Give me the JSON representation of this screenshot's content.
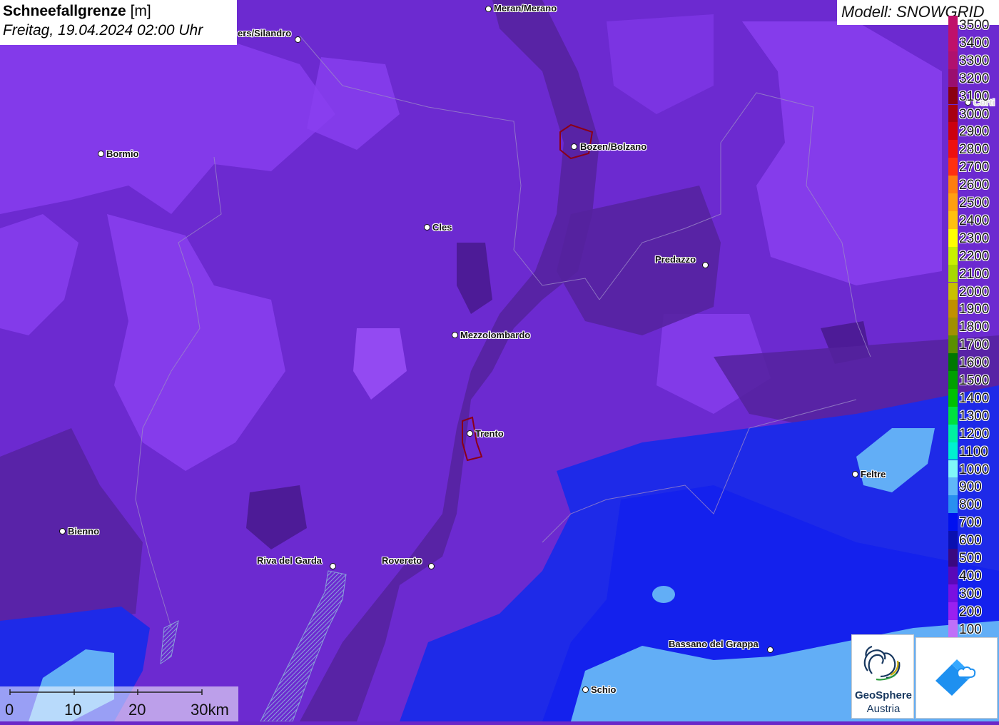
{
  "title": {
    "variable": "Schneefallgrenze",
    "unit": "[m]",
    "datetime": "Freitag, 19.04.2024 02:00 Uhr"
  },
  "model": "Modell: SNOWGRID",
  "cities": [
    {
      "name": "Meran/Merano"
    },
    {
      "name": "ers/Silandro"
    },
    {
      "name": "Bormio"
    },
    {
      "name": "Bozen/Bolzano"
    },
    {
      "name": "Cles"
    },
    {
      "name": "Predazzo"
    },
    {
      "name": "Mezzolombardo"
    },
    {
      "name": "Trento"
    },
    {
      "name": "Feltre"
    },
    {
      "name": "Bienno"
    },
    {
      "name": "Riva del Garda"
    },
    {
      "name": "Rovereto"
    },
    {
      "name": "Bassano del Grappa"
    },
    {
      "name": "Schio"
    },
    {
      "name": "Corti"
    }
  ],
  "legend": [
    {
      "label": "3500",
      "color": "#c0106a"
    },
    {
      "label": "3400",
      "color": "#c0106a"
    },
    {
      "label": "3300",
      "color": "#b0106e"
    },
    {
      "label": "3200",
      "color": "#9a0e6e"
    },
    {
      "label": "3100",
      "color": "#8b0010"
    },
    {
      "label": "3000",
      "color": "#a80010"
    },
    {
      "label": "2900",
      "color": "#cc0010"
    },
    {
      "label": "2800",
      "color": "#ee1010"
    },
    {
      "label": "2700",
      "color": "#ff3010"
    },
    {
      "label": "2600",
      "color": "#ff7e10"
    },
    {
      "label": "2500",
      "color": "#ffa010"
    },
    {
      "label": "2400",
      "color": "#ffc010"
    },
    {
      "label": "2300",
      "color": "#ffff00"
    },
    {
      "label": "2200",
      "color": "#c8f000"
    },
    {
      "label": "2100",
      "color": "#a8d800"
    },
    {
      "label": "2000",
      "color": "#c8c000"
    },
    {
      "label": "1900",
      "color": "#c09000"
    },
    {
      "label": "1800",
      "color": "#a09000"
    },
    {
      "label": "1700",
      "color": "#5a9000"
    },
    {
      "label": "1600",
      "color": "#007800"
    },
    {
      "label": "1500",
      "color": "#00a000"
    },
    {
      "label": "1400",
      "color": "#00c000"
    },
    {
      "label": "1300",
      "color": "#00e040"
    },
    {
      "label": "1200",
      "color": "#00f0a0"
    },
    {
      "label": "1100",
      "color": "#00f0d0"
    },
    {
      "label": "1000",
      "color": "#80f8f8"
    },
    {
      "label": "900",
      "color": "#60b8f8"
    },
    {
      "label": "800",
      "color": "#2890f0"
    },
    {
      "label": "700",
      "color": "#0010f0"
    },
    {
      "label": "600",
      "color": "#0a10b0"
    },
    {
      "label": "500",
      "color": "#3a0880"
    },
    {
      "label": "400",
      "color": "#5a08b8"
    },
    {
      "label": "300",
      "color": "#7a10e0"
    },
    {
      "label": "200",
      "color": "#9a20f0"
    },
    {
      "label": "100",
      "color": "#c070f8"
    }
  ],
  "scale": {
    "labels": [
      "0",
      "10",
      "20",
      "30km"
    ]
  },
  "logos": {
    "geosphere_line1": "GeoSphere",
    "geosphere_line2": "Austria"
  }
}
